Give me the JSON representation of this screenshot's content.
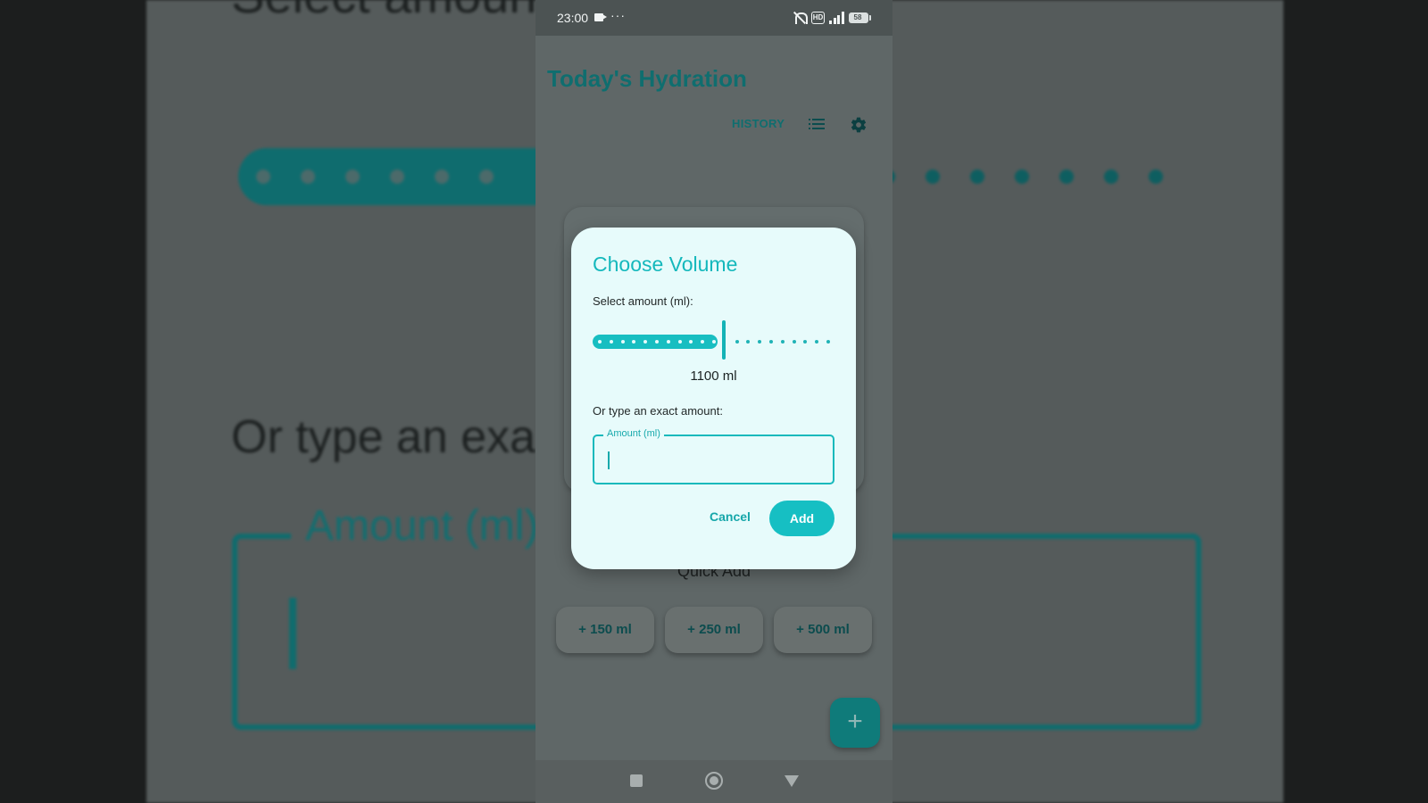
{
  "status_bar": {
    "time": "23:00",
    "more": "···",
    "battery": "58"
  },
  "app": {
    "title": "Today's Hydration",
    "history_label": "HISTORY"
  },
  "quick_add": {
    "label": "Quick Add",
    "buttons": [
      "+ 150 ml",
      "+ 250 ml",
      "+ 500 ml"
    ],
    "fab_label": "+"
  },
  "dialog": {
    "title": "Choose Volume",
    "select_label": "Select amount (ml):",
    "slider": {
      "value_ml": 1100,
      "value_fraction": 0.55,
      "steps": 20,
      "value_text": "1100 ml"
    },
    "hint": "Or type an exact amount:",
    "amount_field": {
      "label": "Amount (ml)",
      "value": ""
    },
    "cancel_label": "Cancel",
    "add_label": "Add"
  },
  "background": {
    "title_fragment": "Select amoun",
    "hint_fragment": "Or type an exa",
    "field_label": "Amount (ml)"
  },
  "colors": {
    "accent": "#16bfc3",
    "dark_teal": "#0f6e6f",
    "dialog_bg": "#e7fbfb"
  }
}
